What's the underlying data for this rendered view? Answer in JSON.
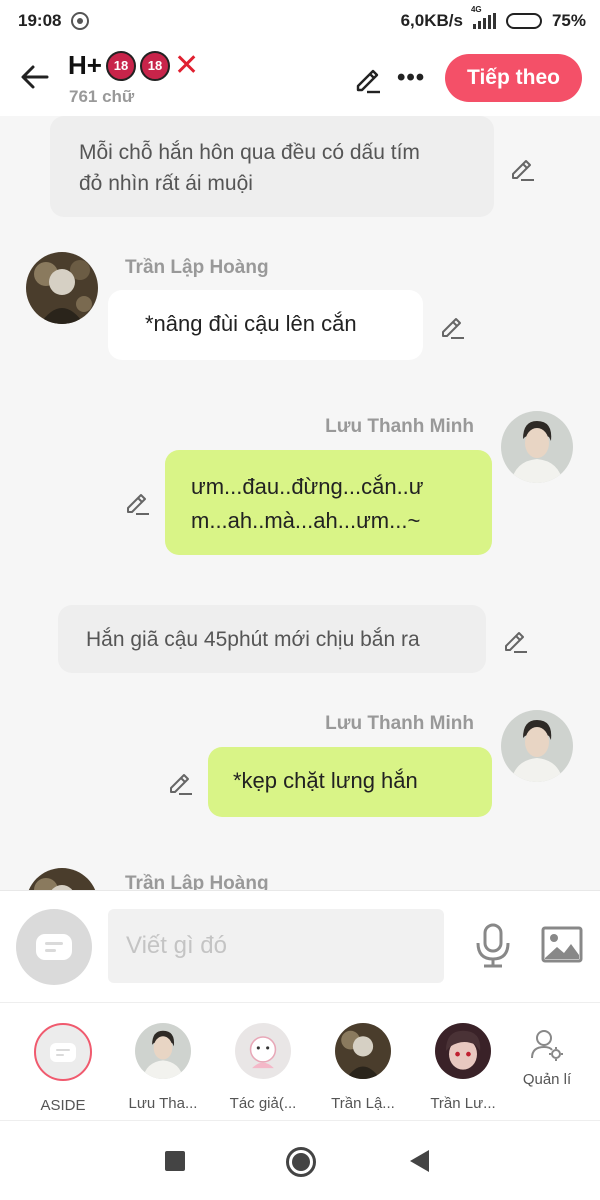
{
  "status": {
    "time": "19:08",
    "network_speed": "6,0KB/s",
    "network_type": "4G",
    "battery": "75%",
    "battery_level": 0.75
  },
  "header": {
    "title": "H+",
    "badges": [
      "18",
      "18"
    ],
    "close_mark": "✕",
    "word_count": "761 chữ",
    "next_label": "Tiếp theo"
  },
  "chat": {
    "narration_1": {
      "lines": [
        "Mỗi chỗ hắn hôn qua đều có dấu tím",
        "đỏ nhìn rất ái muội"
      ]
    },
    "msg_1": {
      "speaker": "Trần Lập Hoàng",
      "text": "*nâng đùi cậu lên cắn"
    },
    "msg_2": {
      "speaker": "Lưu Thanh Minh",
      "lines": [
        "ưm...đau..đừng...cắn..ư",
        "m...ah..mà...ah...ưm...~"
      ]
    },
    "narration_2": {
      "text": "Hắn giã cậu 45phút mới chịu bắn ra"
    },
    "msg_3": {
      "speaker": "Lưu Thanh Minh",
      "text": "*kẹp chặt lưng hắn"
    },
    "msg_4": {
      "speaker": "Trần Lập Hoàng"
    }
  },
  "composer": {
    "placeholder": "Viết gì đó"
  },
  "characters": [
    {
      "label": "ASIDE"
    },
    {
      "label": "Lưu Tha..."
    },
    {
      "label": "Tác giả(..."
    },
    {
      "label": "Trần Lậ..."
    },
    {
      "label": "Trần Lư..."
    },
    {
      "label": "Quản lí"
    }
  ],
  "colors": {
    "accent": "#f45068",
    "green_bubble": "#d9f487",
    "narration_bg": "#eeeeee"
  }
}
